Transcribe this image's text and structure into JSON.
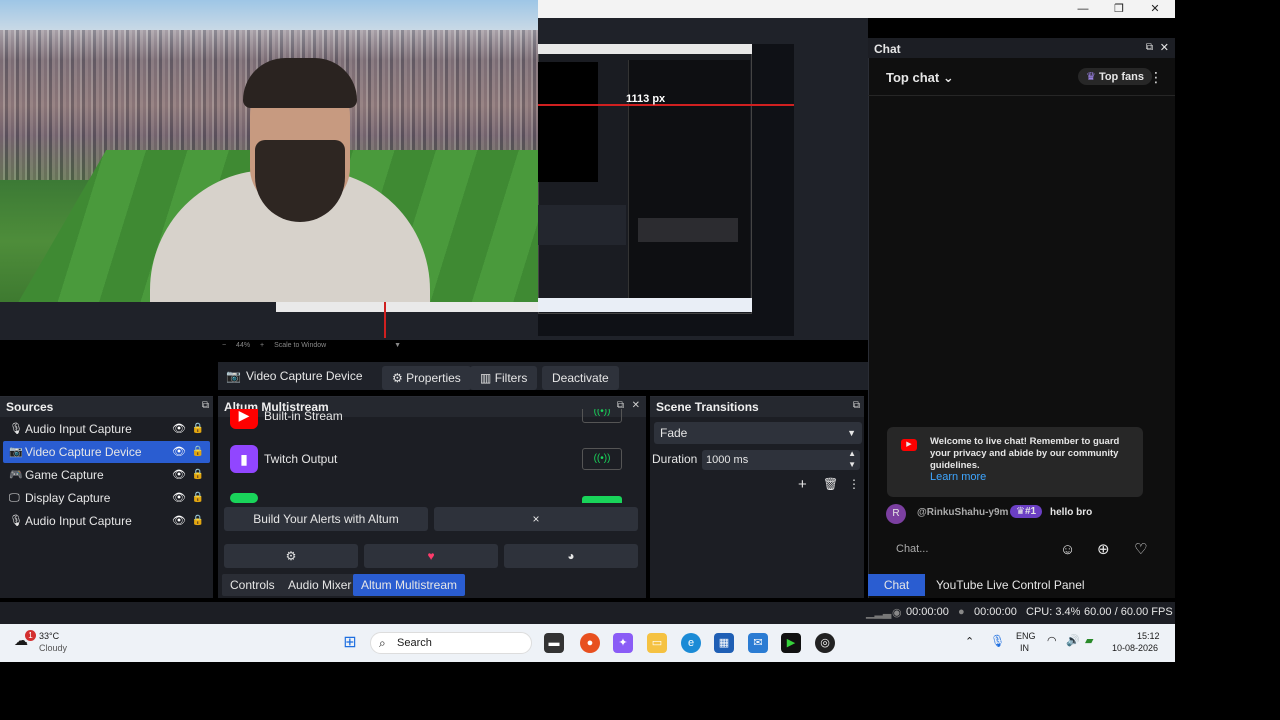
{
  "window": {
    "minimize": "—",
    "maximize": "❐",
    "close": "✕"
  },
  "preview": {
    "px_label": "1113 px",
    "zoom": "44%",
    "scale_mode": "Scale to Window"
  },
  "source_toolbar": {
    "selected_source": "Video Capture Device",
    "properties": "Properties",
    "filters": "Filters",
    "deactivate": "Deactivate"
  },
  "sources": {
    "title": "Sources",
    "items": [
      {
        "label": "Audio Input Capture",
        "icon": "mic-icon"
      },
      {
        "label": "Video Capture Device",
        "icon": "camera-icon",
        "selected": true
      },
      {
        "label": "Game Capture",
        "icon": "gamepad-icon"
      },
      {
        "label": "Display Capture",
        "icon": "monitor-icon"
      },
      {
        "label": "Audio Input Capture",
        "icon": "mic-icon"
      }
    ]
  },
  "altum": {
    "title": "Altum Multistream",
    "outputs": [
      {
        "label": "Built-in Stream"
      },
      {
        "label": "Twitch Output"
      }
    ],
    "build_alerts": "Build Your Alerts with Altum",
    "close": "×"
  },
  "transitions": {
    "title": "Scene Transitions",
    "selected": "Fade",
    "duration_label": "Duration",
    "duration_value": "1000 ms"
  },
  "bottom_tabs": [
    "Controls",
    "Audio Mixer",
    "Altum Multistream"
  ],
  "status": {
    "rec_time": "00:00:00",
    "stream_time": "00:00:00",
    "cpu": "CPU: 3.4%",
    "fps": "60.00 / 60.00 FPS"
  },
  "chat": {
    "dock_title": "Chat",
    "mode": "Top chat",
    "top_fans": "Top fans",
    "welcome": "Welcome to live chat! Remember to guard your privacy and abide by our community guidelines.",
    "learn_more": "Learn more",
    "message": {
      "avatar": "R",
      "author": "@RinkuShahu-y9m",
      "badge": "#1",
      "text": "hello bro"
    },
    "input_placeholder": "Chat...",
    "tabs": [
      "Chat",
      "YouTube Live Control Panel"
    ]
  },
  "taskbar": {
    "weather_badge": "1",
    "temp": "33°C",
    "condition": "Cloudy",
    "search": "Search",
    "lang": "ENG",
    "region": "IN",
    "time": "15:12",
    "date": "10-08-2026"
  },
  "colors": {
    "accent": "#2a5dd1",
    "brand_red": "#ff0000",
    "twitch": "#9146ff",
    "live_green": "#19d45a"
  }
}
